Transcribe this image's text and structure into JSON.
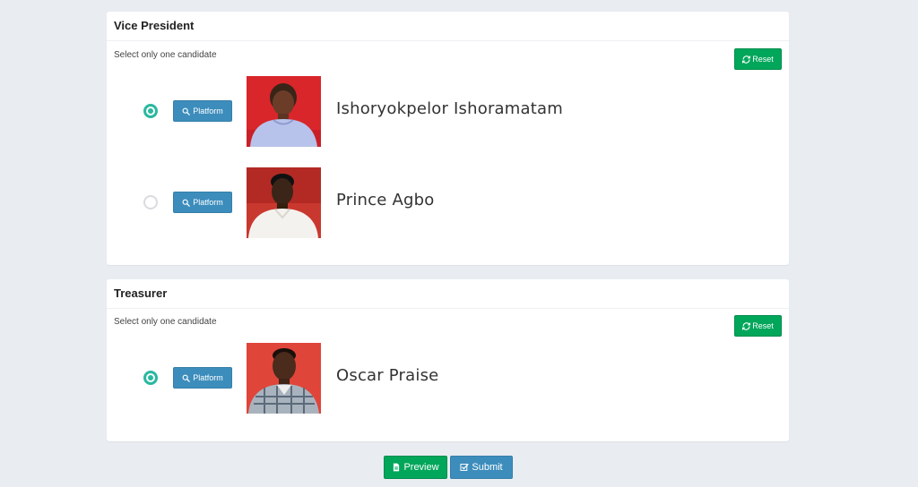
{
  "sections": [
    {
      "title": "Vice President",
      "hint": "Select only one candidate",
      "reset_label": "Reset",
      "candidates": [
        {
          "name": "Ishoryokpelor Ishoramatam",
          "platform_label": "Platform",
          "selected": true
        },
        {
          "name": "Prince Agbo",
          "platform_label": "Platform",
          "selected": false
        }
      ]
    },
    {
      "title": "Treasurer",
      "hint": "Select only one candidate",
      "reset_label": "Reset",
      "candidates": [
        {
          "name": "Oscar Praise",
          "platform_label": "Platform",
          "selected": true
        }
      ]
    }
  ],
  "footer": {
    "preview_label": "Preview",
    "submit_label": "Submit"
  },
  "colors": {
    "page_bg": "#e9ecf1",
    "success": "#00a65a",
    "primary": "#3c8dbc",
    "radio_selected": "#2ab8a0"
  },
  "icons": {
    "reset": "refresh-icon",
    "platform": "search-icon",
    "preview": "file-icon",
    "submit": "check-square-icon"
  }
}
